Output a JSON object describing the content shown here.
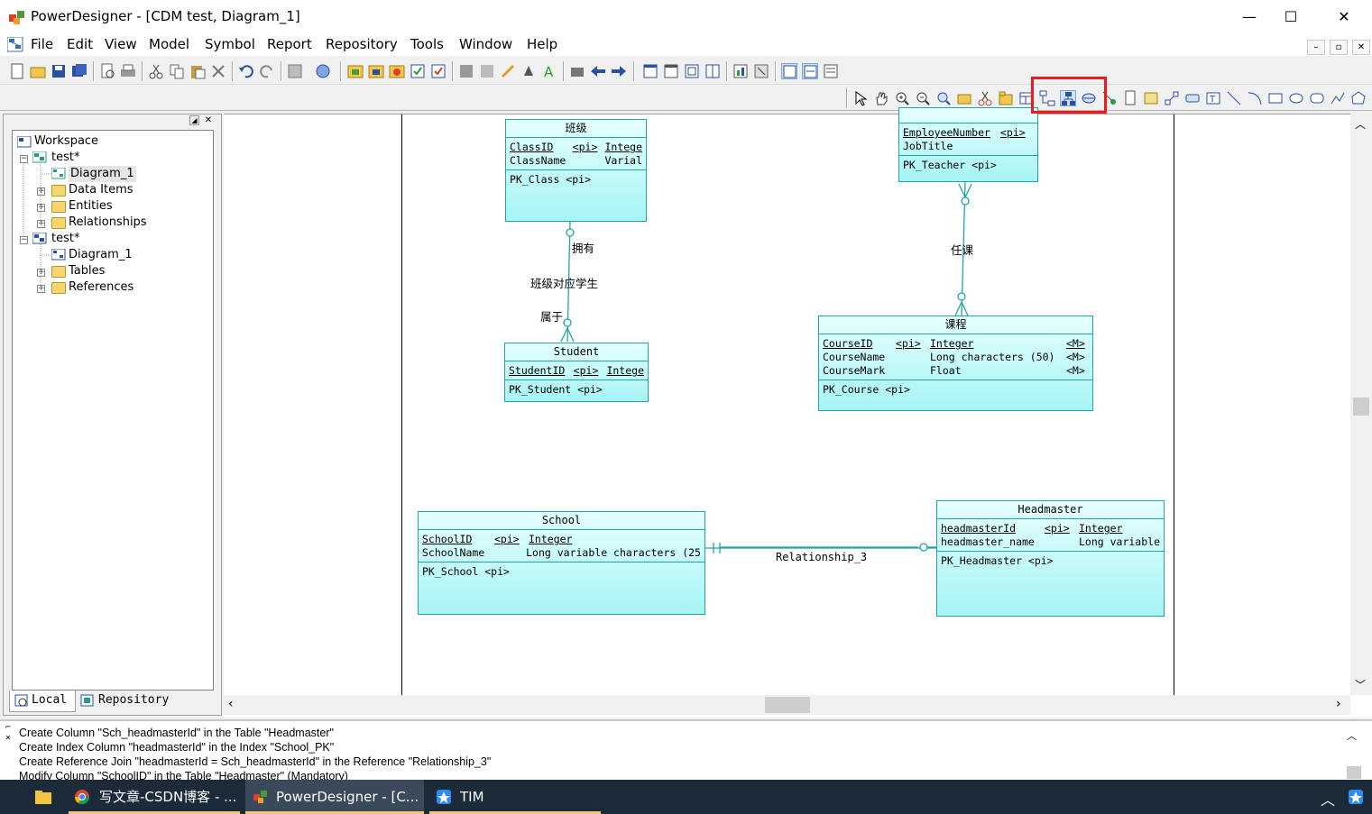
{
  "window": {
    "title": "PowerDesigner - [CDM test, Diagram_1]",
    "min": "—",
    "max": "☐",
    "close": "✕"
  },
  "menu": [
    "File",
    "Edit",
    "View",
    "Model",
    "Symbol",
    "Report",
    "Repository",
    "Tools",
    "Window",
    "Help"
  ],
  "tree": {
    "workspace": "Workspace",
    "model1": {
      "label": "test*",
      "children": [
        "Diagram_1",
        "Data Items",
        "Entities",
        "Relationships"
      ]
    },
    "model2": {
      "label": "test*",
      "children": [
        "Diagram_1",
        "Tables",
        "References"
      ]
    }
  },
  "tabs": {
    "local": "Local",
    "repository": "Repository"
  },
  "entities": {
    "class": {
      "name": "班级",
      "attrs": [
        [
          "ClassID",
          "<pi>",
          "Intege"
        ],
        [
          "ClassName",
          "",
          "Varial"
        ]
      ],
      "ids": [
        "PK_Class  <pi>"
      ]
    },
    "teacher": {
      "name": "",
      "attrs": [
        [
          "EmployeeNumber",
          "<pi>",
          ""
        ],
        [
          "JobTitle",
          "",
          ""
        ]
      ],
      "ids": [
        "PK_Teacher  <pi>"
      ]
    },
    "student": {
      "name": "Student",
      "attrs": [
        [
          "StudentID",
          "<pi>",
          "Intege"
        ]
      ],
      "ids": [
        "PK_Student  <pi>"
      ]
    },
    "course": {
      "name": "课程",
      "attrs": [
        [
          "CourseID",
          "<pi>",
          "Integer",
          "<M>"
        ],
        [
          "CourseName",
          "",
          "Long characters (50)",
          "<M>"
        ],
        [
          "CourseMark",
          "",
          "Float",
          "<M>"
        ]
      ],
      "ids": [
        "PK_Course  <pi>"
      ]
    },
    "school": {
      "name": "School",
      "attrs": [
        [
          "SchoolID",
          "<pi>",
          "Integer"
        ],
        [
          "SchoolName",
          "",
          "Long variable characters (25"
        ]
      ],
      "ids": [
        "PK_School  <pi>"
      ]
    },
    "headmaster": {
      "name": "Headmaster",
      "attrs": [
        [
          "headmasterId",
          "<pi>",
          "Integer"
        ],
        [
          "headmaster_name",
          "",
          "Long variable"
        ]
      ],
      "ids": [
        "PK_Headmaster  <pi>"
      ]
    }
  },
  "relationships": {
    "rel1": {
      "role1": "拥有",
      "name": "班级对应学生",
      "role2": "属于"
    },
    "rel2": {
      "name": "任课"
    },
    "rel3": {
      "name": "Relationship_3"
    }
  },
  "output": [
    "Create Column \"Sch_headmasterId\" in the Table \"Headmaster\"",
    "Create Index Column \"headmasterId\" in the Index \"School_PK\"",
    "Create Reference Join \"headmasterId = Sch_headmasterId\" in the Reference \"Relationship_3\"",
    "Modify Column \"SchoolID\" in the Table \"Headmaster\" (Mandatory)"
  ],
  "taskbar": [
    {
      "label": "写文章-CSDN博客 - ..."
    },
    {
      "label": "PowerDesigner - [C..."
    },
    {
      "label": "TIM"
    }
  ],
  "colors": {
    "entity_border": "#21a4a4",
    "entity_fill": "#a6f4f4",
    "highlight": "#ef1b1b",
    "taskbar": "#1c2b3a"
  }
}
